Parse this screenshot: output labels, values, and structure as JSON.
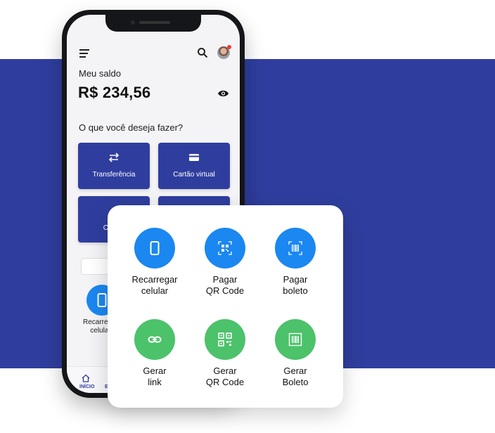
{
  "balance": {
    "label": "Meu saldo",
    "value": "R$ 234,56"
  },
  "question": "O que você deseja fazer?",
  "actions": [
    {
      "label": "Transferência",
      "icon": "transfer-icon"
    },
    {
      "label": "Cartão virtual",
      "icon": "card-icon"
    },
    {
      "label": "Cobrar",
      "icon": "dollar-icon"
    },
    {
      "label": "",
      "icon": "arrows-icon"
    }
  ],
  "mini": {
    "label_line1": "Recarregar",
    "label_line2": "celular"
  },
  "bottom_nav": {
    "home": "INÍCIO",
    "second": "E"
  },
  "panel": {
    "tiles": [
      {
        "line1": "Recarregar",
        "line2": "celular",
        "icon": "phone-icon",
        "color": "#1b87f1"
      },
      {
        "line1": "Pagar",
        "line2": "QR Code",
        "icon": "qr-scan-icon",
        "color": "#1b87f1"
      },
      {
        "line1": "Pagar",
        "line2": "boleto",
        "icon": "barcode-scan-icon",
        "color": "#1b87f1"
      },
      {
        "line1": "Gerar",
        "line2": "link",
        "icon": "link-icon",
        "color": "#4cc26a"
      },
      {
        "line1": "Gerar",
        "line2": "QR Code",
        "icon": "qr-icon",
        "color": "#4cc26a"
      },
      {
        "line1": "Gerar",
        "line2": "Boleto",
        "icon": "barcode-icon",
        "color": "#4cc26a"
      }
    ]
  },
  "colors": {
    "brand": "#2f3e9e",
    "blue": "#1b87f1",
    "green": "#4cc26a"
  }
}
